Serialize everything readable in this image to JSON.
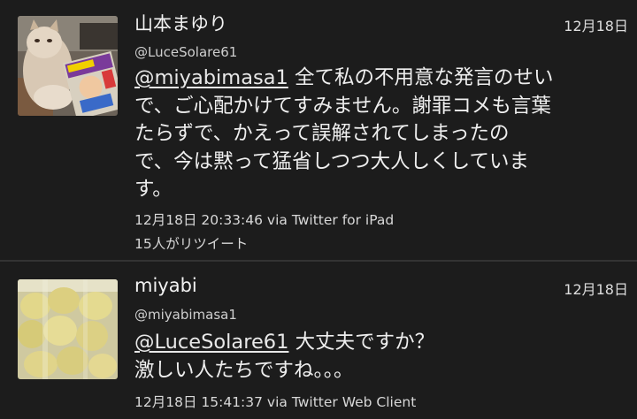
{
  "colors": {
    "background": "#1c1c1c",
    "divider": "#333333",
    "text": "#eeeeee"
  },
  "tweets": [
    {
      "name": "山本まゆり",
      "handle": "@LuceSolare61",
      "date": "12月18日",
      "mention": "@miyabimasa1",
      "lines": [
        "全て私の不用意な発言のせい",
        "で、ご心配かけてすみません。謝罪コメも言葉",
        "たらずで、かえって誤解されてしまったの",
        "で、今は黙って猛省しつつ大人しくしていま",
        "す。"
      ],
      "meta": "12月18日 20:33:46 via Twitter for iPad",
      "retweets": "15人がリツイート",
      "avatar_icon": "cat-photo-avatar"
    },
    {
      "name": "miyabi",
      "handle": "@miyabimasa1",
      "date": "12月18日",
      "mention": "@LuceSolare61",
      "lines": [
        "大丈夫ですか？",
        "激しい人たちですね。。。"
      ],
      "meta": "12月18日 15:41:37 via Twitter Web Client",
      "avatar_icon": "potatoes-photo-avatar"
    }
  ]
}
